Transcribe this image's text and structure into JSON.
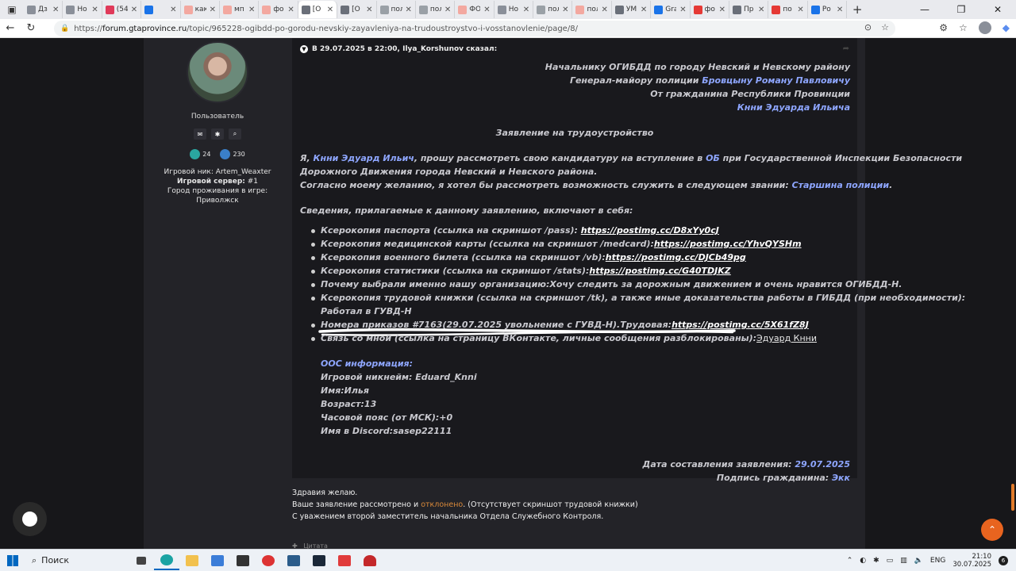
{
  "browser": {
    "tabs": [
      {
        "title": "Дз",
        "color": "#8a8f99"
      },
      {
        "title": "Но",
        "color": "#8a8f99"
      },
      {
        "title": "(54",
        "color": "#e03a5a"
      },
      {
        "title": "",
        "color": "#1a73e8"
      },
      {
        "title": "как",
        "color": "#f3a8a0"
      },
      {
        "title": "мп",
        "color": "#f3a8a0"
      },
      {
        "title": "фо",
        "color": "#f3a8a0"
      },
      {
        "title": "[О",
        "color": "#6a6f79"
      },
      {
        "title": "[О",
        "color": "#6a6f79"
      },
      {
        "title": "пол",
        "color": "#9aa0a6"
      },
      {
        "title": "пол",
        "color": "#9aa0a6"
      },
      {
        "title": "ФО",
        "color": "#f3a8a0"
      },
      {
        "title": "Но",
        "color": "#8a8f99"
      },
      {
        "title": "пол",
        "color": "#9aa0a6"
      },
      {
        "title": "пол",
        "color": "#f3a8a0"
      },
      {
        "title": "УМ",
        "color": "#6a6f79"
      },
      {
        "title": "Gra",
        "color": "#1a73e8"
      },
      {
        "title": "фо",
        "color": "#e53935"
      },
      {
        "title": "Пр",
        "color": "#6a6f79"
      },
      {
        "title": "по",
        "color": "#e53935"
      },
      {
        "title": "Ро",
        "color": "#1a73e8"
      }
    ],
    "active_tab": 7,
    "url_prefix": "https://",
    "url_host": "forum.gtaprovince.ru",
    "url_path": "/topic/965228-ogibdd-po-gorodu-nevskiy-zayavleniya-na-trudoustroystvo-i-vosstanovlenie/page/8/"
  },
  "author": {
    "role": "Пользователь",
    "likes": "24",
    "posts": "230",
    "nick_label": "Игровой ник:",
    "nick": "Artem_Weaxter",
    "server_label": "Игровой сервер:",
    "server": "#1",
    "city_label": "Город проживания в игре:",
    "city": "Приволжск"
  },
  "quote": {
    "header": "В 29.07.2025 в 22:00, Ilya_Korshunov сказал:",
    "addr_1": "Начальнику ОГИБДД по городу Невский и Невскому району",
    "addr_2_pre": "Генерал-майору полиции ",
    "addr_2_name": "Бровцыну Роману Павловичу",
    "addr_3": "От гражданина Республики Провинции",
    "addr_4": "Кнни Эдуарда Ильича",
    "title": "Заявление на трудоустройство",
    "p1_a": "Я, ",
    "p1_name": "Кнни Эдуард Ильич",
    "p1_b": ", прошу рассмотреть свою кандидатуру на вступление в ",
    "p1_dept": "ОБ",
    "p1_c": " при Государственной Инспекции Безопасности",
    "p1_line2": "Дорожного Движения города Невский и Невского района.",
    "p2_a": "Согласно моему желанию, я хотел бы рассмотреть возможность служить в следующем звании: ",
    "p2_rank": "Старшина полиции",
    "p2_dot": ".",
    "docs_title": "Сведения, прилагаемые к данному заявлению, включают в себя:",
    "items": [
      {
        "label": "Ксерокопия паспорта (ссылка на скриншот /pass): ",
        "link": "https://postimg.cc/D8xYy0cJ"
      },
      {
        "label": "Ксерокопия медицинской карты (ссылка на скриншот /medcard):",
        "link": "https://postimg.cc/YhvQYSHm"
      },
      {
        "label": "Ксерокопия военного билета (ссылка на скриншот /vb):",
        "link": "https://postimg.cc/DJCb49pg"
      },
      {
        "label": "Ксерокопия статистики (ссылка на скриншот /stats):",
        "link": "https://postimg.cc/G40TDJKZ"
      }
    ],
    "reason": "Почему выбрали именно нашу организацию:Хочу следить за дорожным движением и очень нравится ОГИБДД-Н.",
    "work_1": "Ксерокопия трудовой книжки (ссылка на скриншот /tk), а также иные доказательства работы в ГИБДД (при необходимости):",
    "work_2": "Работал в ГУВД-Н",
    "orders_label": "Номера приказов #7163(29.07.2025 увольнение с ГУВД-Н).Трудовая:",
    "orders_link": "https://postimg.cc/5X61fZ8J",
    "contact_label": "Связь со мной (ссылка на страницу ВКонтакте, личные сообщения разблокированы):",
    "contact_link": "Эдуард Кнни",
    "ooc_title": "ООС информация:",
    "ooc_nick": "Игровой никнейм: Eduard_Knni",
    "ooc_name": "Имя:Илья",
    "ooc_age": "Возраст:13",
    "ooc_tz": "Часовой пояс (от МСК):+0",
    "ooc_discord": "Имя в Discord:sasep22111",
    "date_label": "Дата составления заявления: ",
    "date": "29.07.2025",
    "sign_label": "Подпись гражданина: ",
    "sign": "Экк"
  },
  "reply": {
    "line1": "Здравия желаю.",
    "line2_a": "Ваше заявление рассмотрено и ",
    "line2_status": "отклонено",
    "line2_b": ". (Отсутствует скриншот трудовой книжки)",
    "line3": "С уважением второй заместитель начальника Отдела Служебного Контроля.",
    "foot": "Цитата"
  },
  "taskbar": {
    "search": "Поиск",
    "lang": "ENG",
    "time": "21:10",
    "date": "30.07.2025",
    "notifications": "6"
  },
  "colors": {
    "accent_blue": "#8ea6ff",
    "declined": "#d9893a",
    "to_top": "#e8641f"
  }
}
